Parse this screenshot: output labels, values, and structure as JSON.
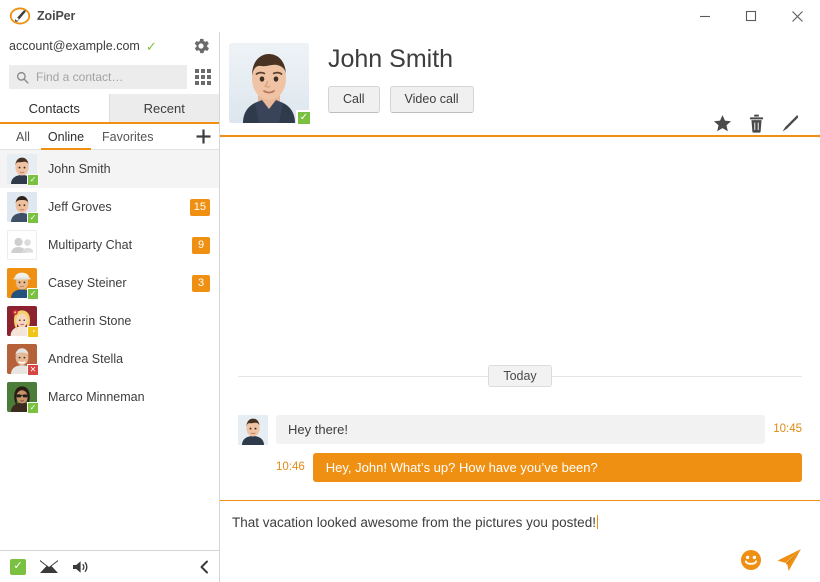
{
  "window": {
    "brand_name": "ZoiPer",
    "logo_icon": "phone-handset-logo",
    "minimize_label": "–",
    "maximize_label": "□",
    "close_label": "✕"
  },
  "sidebar": {
    "account": {
      "email": "account@example.com",
      "registered_check": "✓",
      "settings_icon": "gear-icon"
    },
    "search": {
      "placeholder": "Find a contact…",
      "value": "",
      "icon": "search-icon",
      "dialpad_icon": "dialpad-grid-icon"
    },
    "tabs": [
      {
        "label": "Contacts",
        "active": true
      },
      {
        "label": "Recent",
        "active": false
      }
    ],
    "subtabs": [
      {
        "label": "All",
        "active": false
      },
      {
        "label": "Online",
        "active": true
      },
      {
        "label": "Favorites",
        "active": false
      }
    ],
    "add_contact_label": "+",
    "contacts": [
      {
        "name": "John Smith",
        "status": "online",
        "unread": "",
        "selected": true,
        "avatar": "man-dark-hair"
      },
      {
        "name": "Jeff Groves",
        "status": "online",
        "unread": "15",
        "selected": false,
        "avatar": "man-short-hair"
      },
      {
        "name": "Multiparty Chat",
        "status": "none",
        "unread": "9",
        "selected": false,
        "avatar": "group-placeholder"
      },
      {
        "name": "Casey Steiner",
        "status": "online",
        "unread": "3",
        "selected": false,
        "avatar": "man-cap-orange"
      },
      {
        "name": "Catherin Stone",
        "status": "away",
        "unread": "",
        "selected": false,
        "avatar": "woman-blonde-flower"
      },
      {
        "name": "Andrea Stella",
        "status": "offline",
        "unread": "",
        "selected": false,
        "avatar": "older-man"
      },
      {
        "name": "Marco Minneman",
        "status": "online",
        "unread": "",
        "selected": false,
        "avatar": "woman-sunglasses"
      }
    ],
    "footer": {
      "status_icon": "available-check-icon",
      "messages_icon": "envelope-icon",
      "sound_icon": "speaker-icon",
      "collapse_icon": "chevron-left-icon"
    }
  },
  "chat": {
    "contact_name": "John Smith",
    "contact_status": "online",
    "contact_avatar": "man-dark-hair-large",
    "actions": [
      {
        "label": "Call"
      },
      {
        "label": "Video call"
      }
    ],
    "tools": [
      {
        "icon": "star-icon"
      },
      {
        "icon": "trash-icon"
      },
      {
        "icon": "pencil-icon"
      }
    ],
    "day_divider": "Today",
    "messages": [
      {
        "direction": "in",
        "text": "Hey there!",
        "time": "10:45",
        "avatar": "man-dark-hair"
      },
      {
        "direction": "out",
        "text": "Hey, John! What’s up? How have you’ve been?",
        "time": "10:46"
      }
    ],
    "composer": {
      "value": "That vacation looked awesome from the pictures you posted!",
      "emoji_icon": "smiley-icon",
      "send_icon": "paper-plane-send-icon"
    }
  },
  "colors": {
    "accent": "#ef9012",
    "online": "#7ac142",
    "away": "#f0c419",
    "offline": "#d64541",
    "bubble_in": "#f2f2f2",
    "text": "#3d3d3d"
  }
}
